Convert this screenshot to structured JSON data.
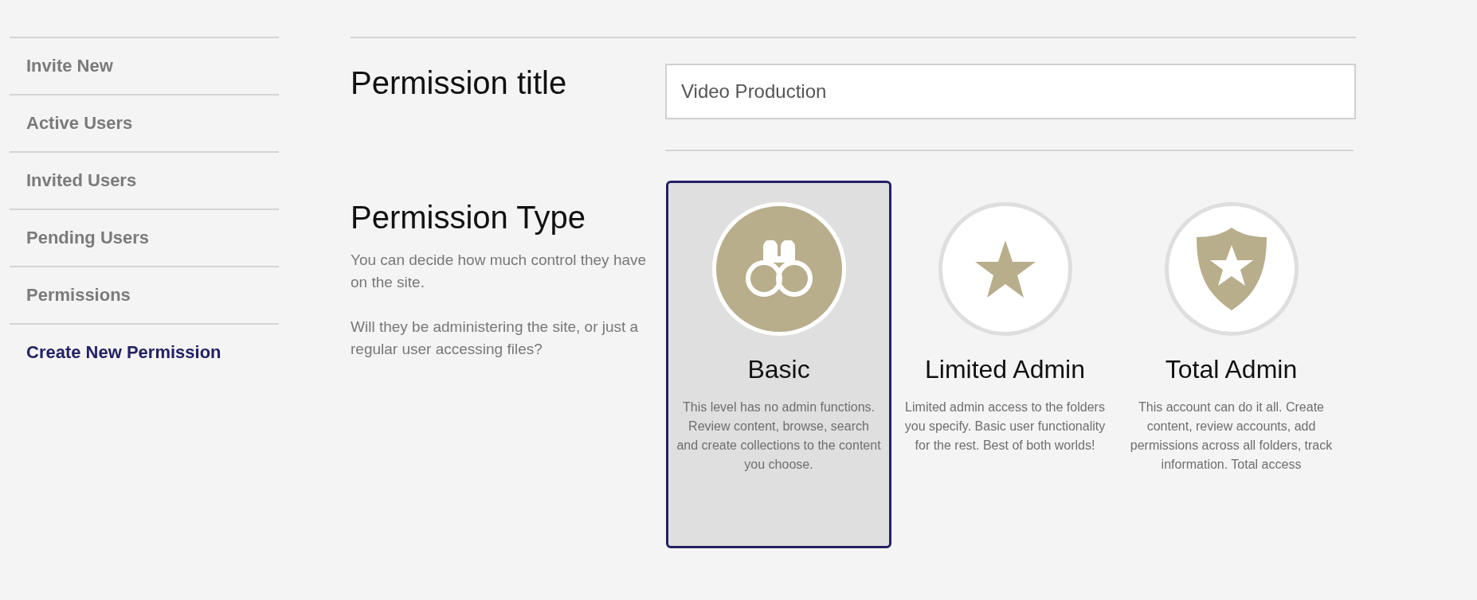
{
  "sidebar": {
    "items": [
      {
        "label": "Invite New",
        "selected": false
      },
      {
        "label": "Active Users",
        "selected": false
      },
      {
        "label": "Invited Users",
        "selected": false
      },
      {
        "label": "Pending Users",
        "selected": false
      },
      {
        "label": "Permissions",
        "selected": false
      },
      {
        "label": "Create New Permission",
        "selected": true
      }
    ]
  },
  "title_field": {
    "label": "Permission title",
    "value": "Video Production"
  },
  "permission_type": {
    "heading": "Permission Type",
    "paragraphs": [
      "You can decide how much control they have on the site.",
      "Will they be administering the site, or just a regular user accessing files?"
    ],
    "options": [
      {
        "kind": "binoculars",
        "title": "Basic",
        "description": "This level has no admin functions. Review content, browse, search and create collections to the content you choose.",
        "selected": true
      },
      {
        "kind": "star",
        "title": "Limited Admin",
        "description": "Limited admin access to the folders you specify. Basic user functionality for the rest. Best of both worlds!",
        "selected": false
      },
      {
        "kind": "shield",
        "title": "Total Admin",
        "description": "This account can do it all. Create content, review accounts, add permissions across all folders, track information. Total access",
        "selected": false
      }
    ]
  }
}
